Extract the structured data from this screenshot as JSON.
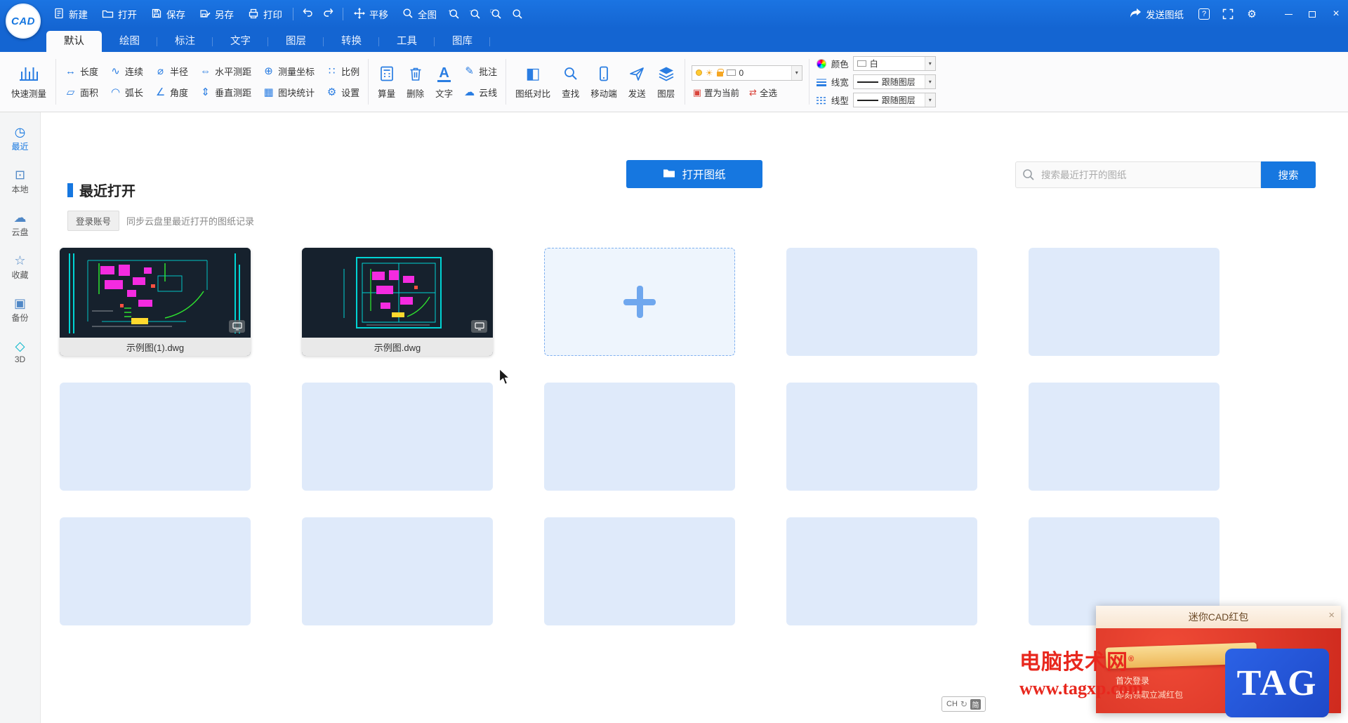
{
  "logo": "CAD",
  "titlebar": {
    "file_buttons": [
      {
        "label": "新建"
      },
      {
        "label": "打开"
      },
      {
        "label": "保存"
      },
      {
        "label": "另存"
      },
      {
        "label": "打印"
      }
    ],
    "pan_label": "平移",
    "fit_label": "全图",
    "zoom_mods": [
      "+",
      "−",
      "□",
      ""
    ],
    "send_label": "发送图纸",
    "help_glyph": "?",
    "gear_glyph": "⚙",
    "close_glyph": "×"
  },
  "tabs": [
    {
      "label": "默认"
    },
    {
      "label": "绘图"
    },
    {
      "label": "标注"
    },
    {
      "label": "文字"
    },
    {
      "label": "图层"
    },
    {
      "label": "转换"
    },
    {
      "label": "工具"
    },
    {
      "label": "图库"
    }
  ],
  "ribbon": {
    "quick_measure": "快速测量",
    "measure_buttons": [
      {
        "g": "↔",
        "label": "长度"
      },
      {
        "g": "▱",
        "label": "面积"
      },
      {
        "g": "∿",
        "label": "连续"
      },
      {
        "g": "◠",
        "label": "弧长"
      },
      {
        "g": "⌀",
        "label": "半径"
      },
      {
        "g": "∠",
        "label": "角度"
      },
      {
        "g": "⇔",
        "label": "水平测距"
      },
      {
        "g": "⇕",
        "label": "垂直测距"
      },
      {
        "g": "⊕",
        "label": "测量坐标"
      },
      {
        "g": "▦",
        "label": "图块统计"
      },
      {
        "g": "∷",
        "label": "比例"
      },
      {
        "g": "⚙",
        "label": "设置"
      }
    ],
    "big_buttons_1": [
      {
        "label": "算量"
      },
      {
        "label": "删除"
      },
      {
        "label": "文字",
        "g": "A"
      }
    ],
    "annotate_buttons": [
      {
        "g": "✎",
        "label": "批注"
      },
      {
        "g": "☁",
        "label": "云线"
      }
    ],
    "big_buttons_2": [
      {
        "label": "图纸对比",
        "g": "◧"
      },
      {
        "label": "查找"
      },
      {
        "label": "移动端"
      },
      {
        "label": "发送"
      },
      {
        "label": "图层"
      }
    ],
    "layer_combo_value": "0",
    "sun_glyph": "☀",
    "chevron": "▾",
    "layer_actions": [
      {
        "g": "▣",
        "label": "置为当前"
      },
      {
        "g": "⇄",
        "label": "全选"
      }
    ],
    "style_rows": [
      {
        "label": "颜色",
        "value": "白"
      },
      {
        "label": "线宽",
        "value": "跟随图层"
      },
      {
        "label": "线型",
        "value": "跟随图层"
      }
    ]
  },
  "sidebar": {
    "items": [
      {
        "g": "◷",
        "label": "最近"
      },
      {
        "g": "⊡",
        "label": "本地"
      },
      {
        "g": "☁",
        "label": "云盘"
      },
      {
        "g": "☆",
        "label": "收藏"
      },
      {
        "g": "▣",
        "label": "备份"
      },
      {
        "g": "◇",
        "label": "3D"
      }
    ]
  },
  "content": {
    "section_title": "最近打开",
    "open_button": "打开图纸",
    "search_placeholder": "搜索最近打开的图纸",
    "search_button": "搜索",
    "login_button": "登录账号",
    "login_hint": "同步云盘里最近打开的图纸记录",
    "files": [
      {
        "name": "示例图(1).dwg"
      },
      {
        "name": "示例图.dwg"
      }
    ]
  },
  "popup": {
    "title": "迷你CAD红包",
    "close": "×",
    "line1": "首次登录",
    "line2": "即刻领取立减红包"
  },
  "watermark": {
    "name": "电脑技术网",
    "reg": "®",
    "url": "www.tagxp.com",
    "tag": "TAG"
  },
  "lang": {
    "code": "CH",
    "glyph": "↻",
    "zh": "简"
  }
}
